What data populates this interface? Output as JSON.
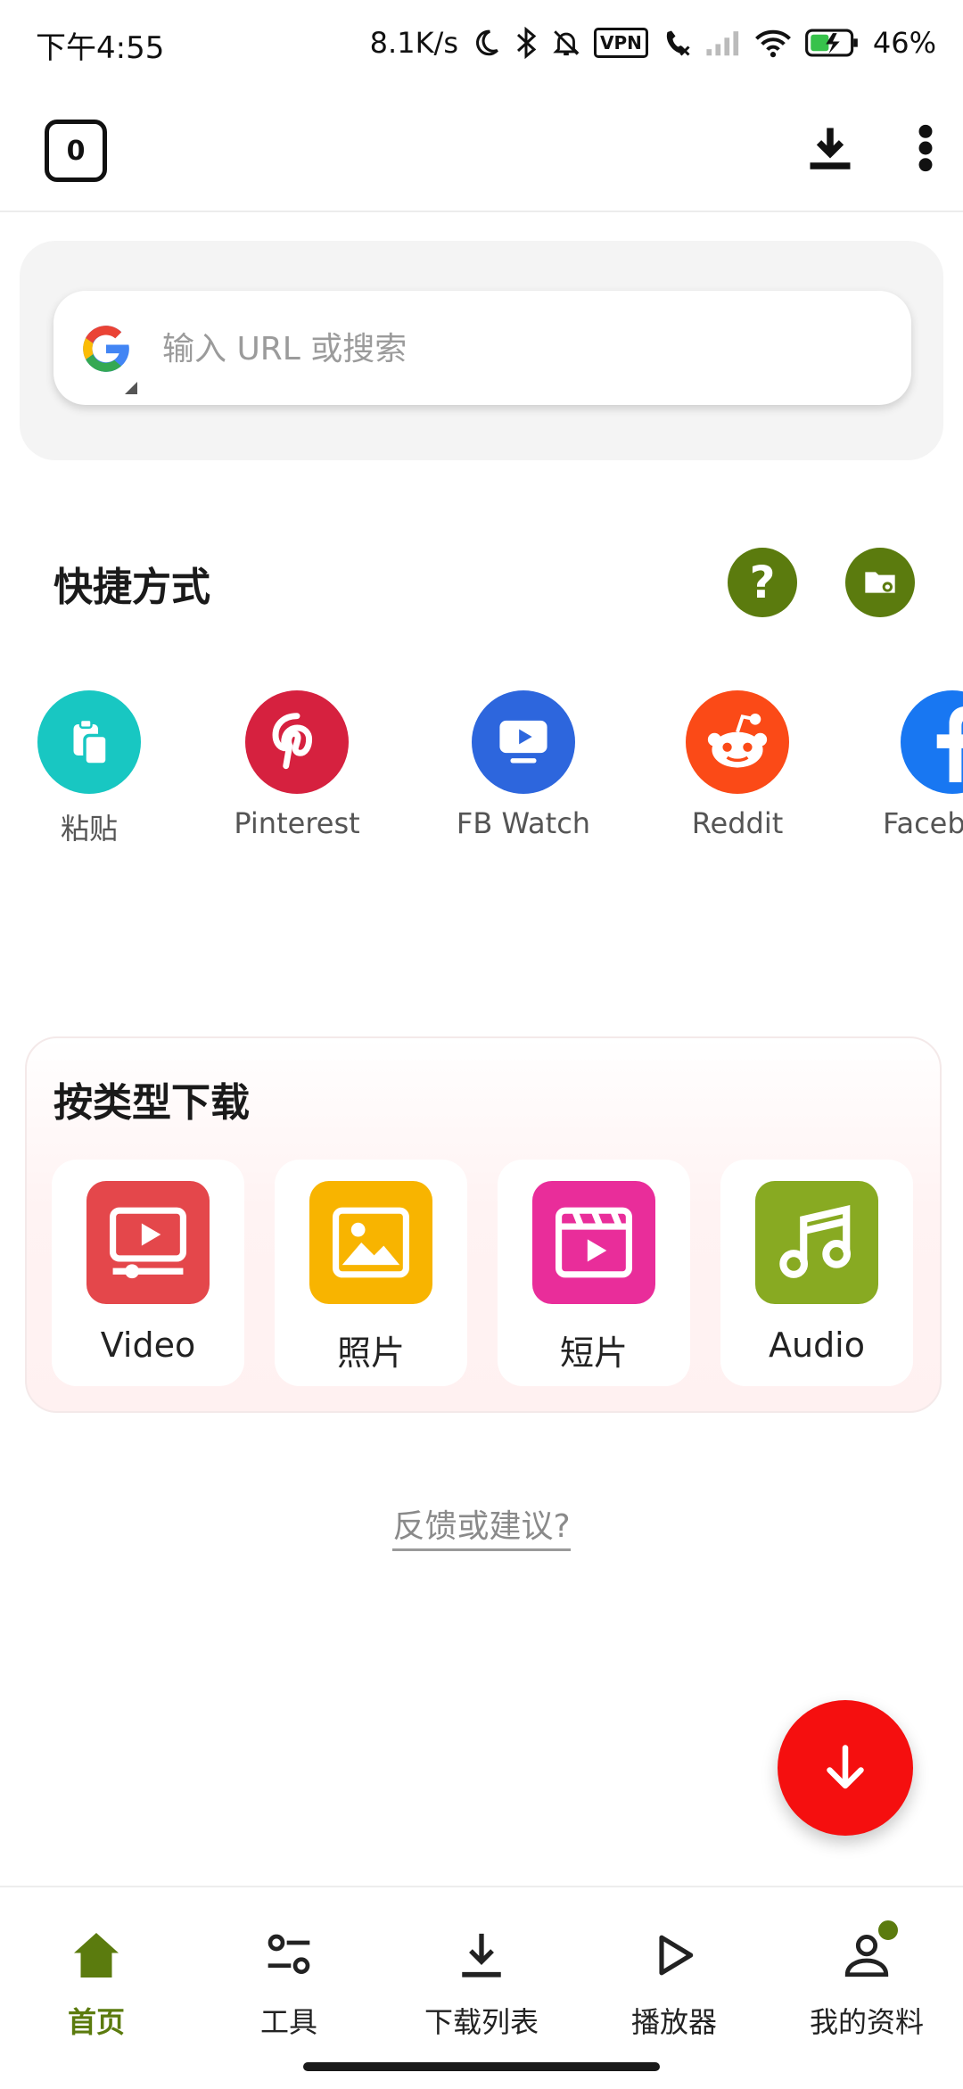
{
  "status_bar": {
    "time": "下午4:55",
    "net_speed": "8.1K/s",
    "vpn": "VPN",
    "battery": "46%",
    "icons": [
      "moon-icon",
      "bluetooth-icon",
      "mute-bell-icon",
      "vpn-icon",
      "call-off-icon",
      "signal-icon",
      "wifi-icon",
      "battery-charging-icon"
    ]
  },
  "toolbar": {
    "tab_count": "0",
    "download_icon": "download-icon",
    "more_icon": "more-vert-icon"
  },
  "search": {
    "placeholder": "输入 URL 或搜索",
    "engine_icon": "google-logo"
  },
  "shortcuts": {
    "title": "快捷方式",
    "help_icon": "help-icon",
    "folder_settings_icon": "folder-settings-icon",
    "items": [
      {
        "label": "粘贴",
        "color": "#18c7c2",
        "icon": "paste-icon"
      },
      {
        "label": "Pinterest",
        "color": "#d6213f",
        "icon": "pinterest-icon"
      },
      {
        "label": "FB Watch",
        "color": "#2d66dd",
        "icon": "fb-watch-icon"
      },
      {
        "label": "Reddit",
        "color": "#fb4a17",
        "icon": "reddit-icon"
      },
      {
        "label": "Faceb",
        "color": "#1877f2",
        "icon": "facebook-icon"
      }
    ]
  },
  "category": {
    "title": "按类型下载",
    "items": [
      {
        "label": "Video",
        "color": "#e4474b",
        "icon": "video-icon"
      },
      {
        "label": "照片",
        "color": "#f8b400",
        "icon": "photo-icon"
      },
      {
        "label": "短片",
        "color": "#e92d9a",
        "icon": "clip-icon"
      },
      {
        "label": "Audio",
        "color": "#88aa22",
        "icon": "music-note-icon"
      }
    ]
  },
  "feedback": {
    "label": "反馈或建议?"
  },
  "fab": {
    "icon": "arrow-down-icon",
    "color": "#f50f0f"
  },
  "bottom_nav": {
    "accent": "#5b7b0e",
    "items": [
      {
        "label": "首页",
        "icon": "home-icon",
        "active": true
      },
      {
        "label": "工具",
        "icon": "tools-icon",
        "active": false
      },
      {
        "label": "下载列表",
        "icon": "download-list-icon",
        "active": false
      },
      {
        "label": "播放器",
        "icon": "play-icon",
        "active": false
      },
      {
        "label": "我的资料",
        "icon": "profile-icon",
        "active": false
      }
    ]
  }
}
